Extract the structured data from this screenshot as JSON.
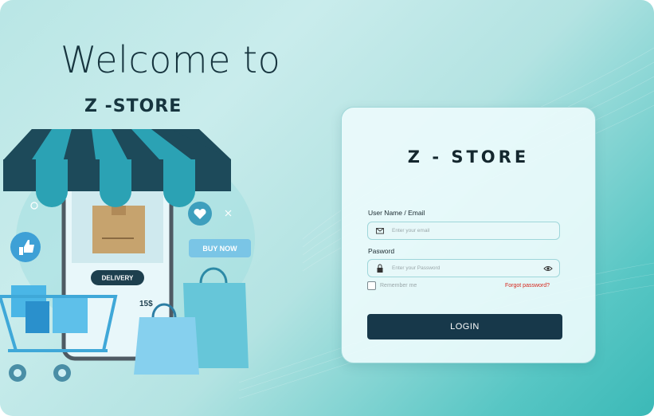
{
  "welcome": {
    "title": "Welcome to",
    "brand": "Z -STORE"
  },
  "illustration": {
    "delivery_label": "DELIVERY",
    "price_label": "15$",
    "buy_now_label": "BUY NOW"
  },
  "login_form": {
    "brand": "Z - STORE",
    "username_label": "User Name / Email",
    "username_placeholder": "Enter your email",
    "password_label": "Pasword",
    "password_placeholder": "Enter your Password",
    "remember_label": "Remember me",
    "remember_checked": false,
    "forgot_label": "Forgot password?",
    "login_label": "LOGIN"
  },
  "colors": {
    "primary_dark": "#17384a",
    "accent_teal": "#3bb9b7",
    "forgot_red": "#d6261c"
  }
}
